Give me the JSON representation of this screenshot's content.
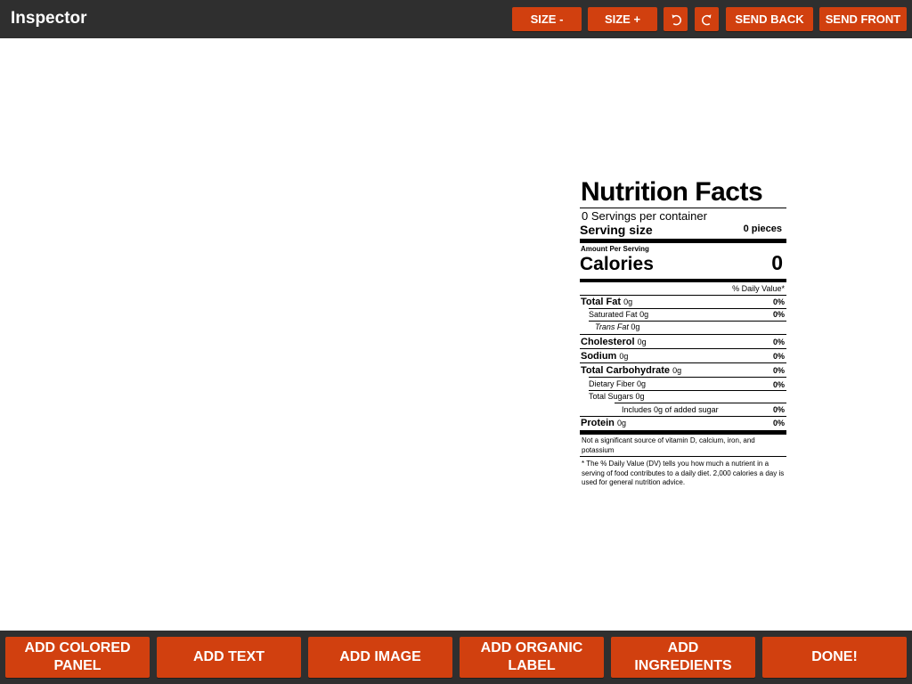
{
  "header": {
    "title": "Inspector",
    "size_minus": "SIZE -",
    "size_plus": "SIZE +",
    "send_back": "SEND BACK",
    "send_front": "SEND FRONT"
  },
  "icons": {
    "rotate_left": "rotate-ccw-icon",
    "rotate_right": "rotate-cw-icon"
  },
  "colors": {
    "accent": "#d1400f",
    "bar": "#2f2f2f",
    "canvas": "#ffffff"
  },
  "nutrition": {
    "title": "Nutrition Facts",
    "servings_per_container": "0 Servings per container",
    "serving_size_label": "Serving size",
    "serving_size_value": "0 pieces",
    "amount_per_serving": "Amount Per Serving",
    "calories_label": "Calories",
    "calories_value": "0",
    "daily_value_header": "% Daily Value*",
    "rows": [
      {
        "label": "Total Fat",
        "amount": "0g",
        "pct": "0%"
      },
      {
        "label": "Saturated Fat",
        "amount": "0g",
        "pct": "0%"
      },
      {
        "label": "Trans Fat",
        "amount": "0g",
        "pct": ""
      },
      {
        "label": "Cholesterol",
        "amount": "0g",
        "pct": "0%"
      },
      {
        "label": "Sodium",
        "amount": "0g",
        "pct": "0%"
      },
      {
        "label": "Total Carbohydrate",
        "amount": "0g",
        "pct": "0%"
      },
      {
        "label": "Dietary Fiber",
        "amount": "0g",
        "pct": "0%"
      },
      {
        "label": "Total Sugars",
        "amount": "0g",
        "pct": ""
      },
      {
        "label": "Includes",
        "amount": "0g of added sugar",
        "pct": "0%"
      },
      {
        "label": "Protein",
        "amount": "0g",
        "pct": "0%"
      }
    ],
    "vitamins_note": "Not a significant source of vitamin D, calcium, iron, and potassium",
    "footnote": "* The % Daily Value (DV) tells you how much a nutrient in a serving of food contributes to a daily diet. 2,000 calories a day is used for general nutrition advice."
  },
  "footer": {
    "add_colored_panel": "ADD COLORED\nPANEL",
    "add_text": "ADD TEXT",
    "add_image": "ADD IMAGE",
    "add_organic_label": "ADD ORGANIC\nLABEL",
    "add_ingredients": "ADD\nINGREDIENTS",
    "done": "DONE!"
  }
}
